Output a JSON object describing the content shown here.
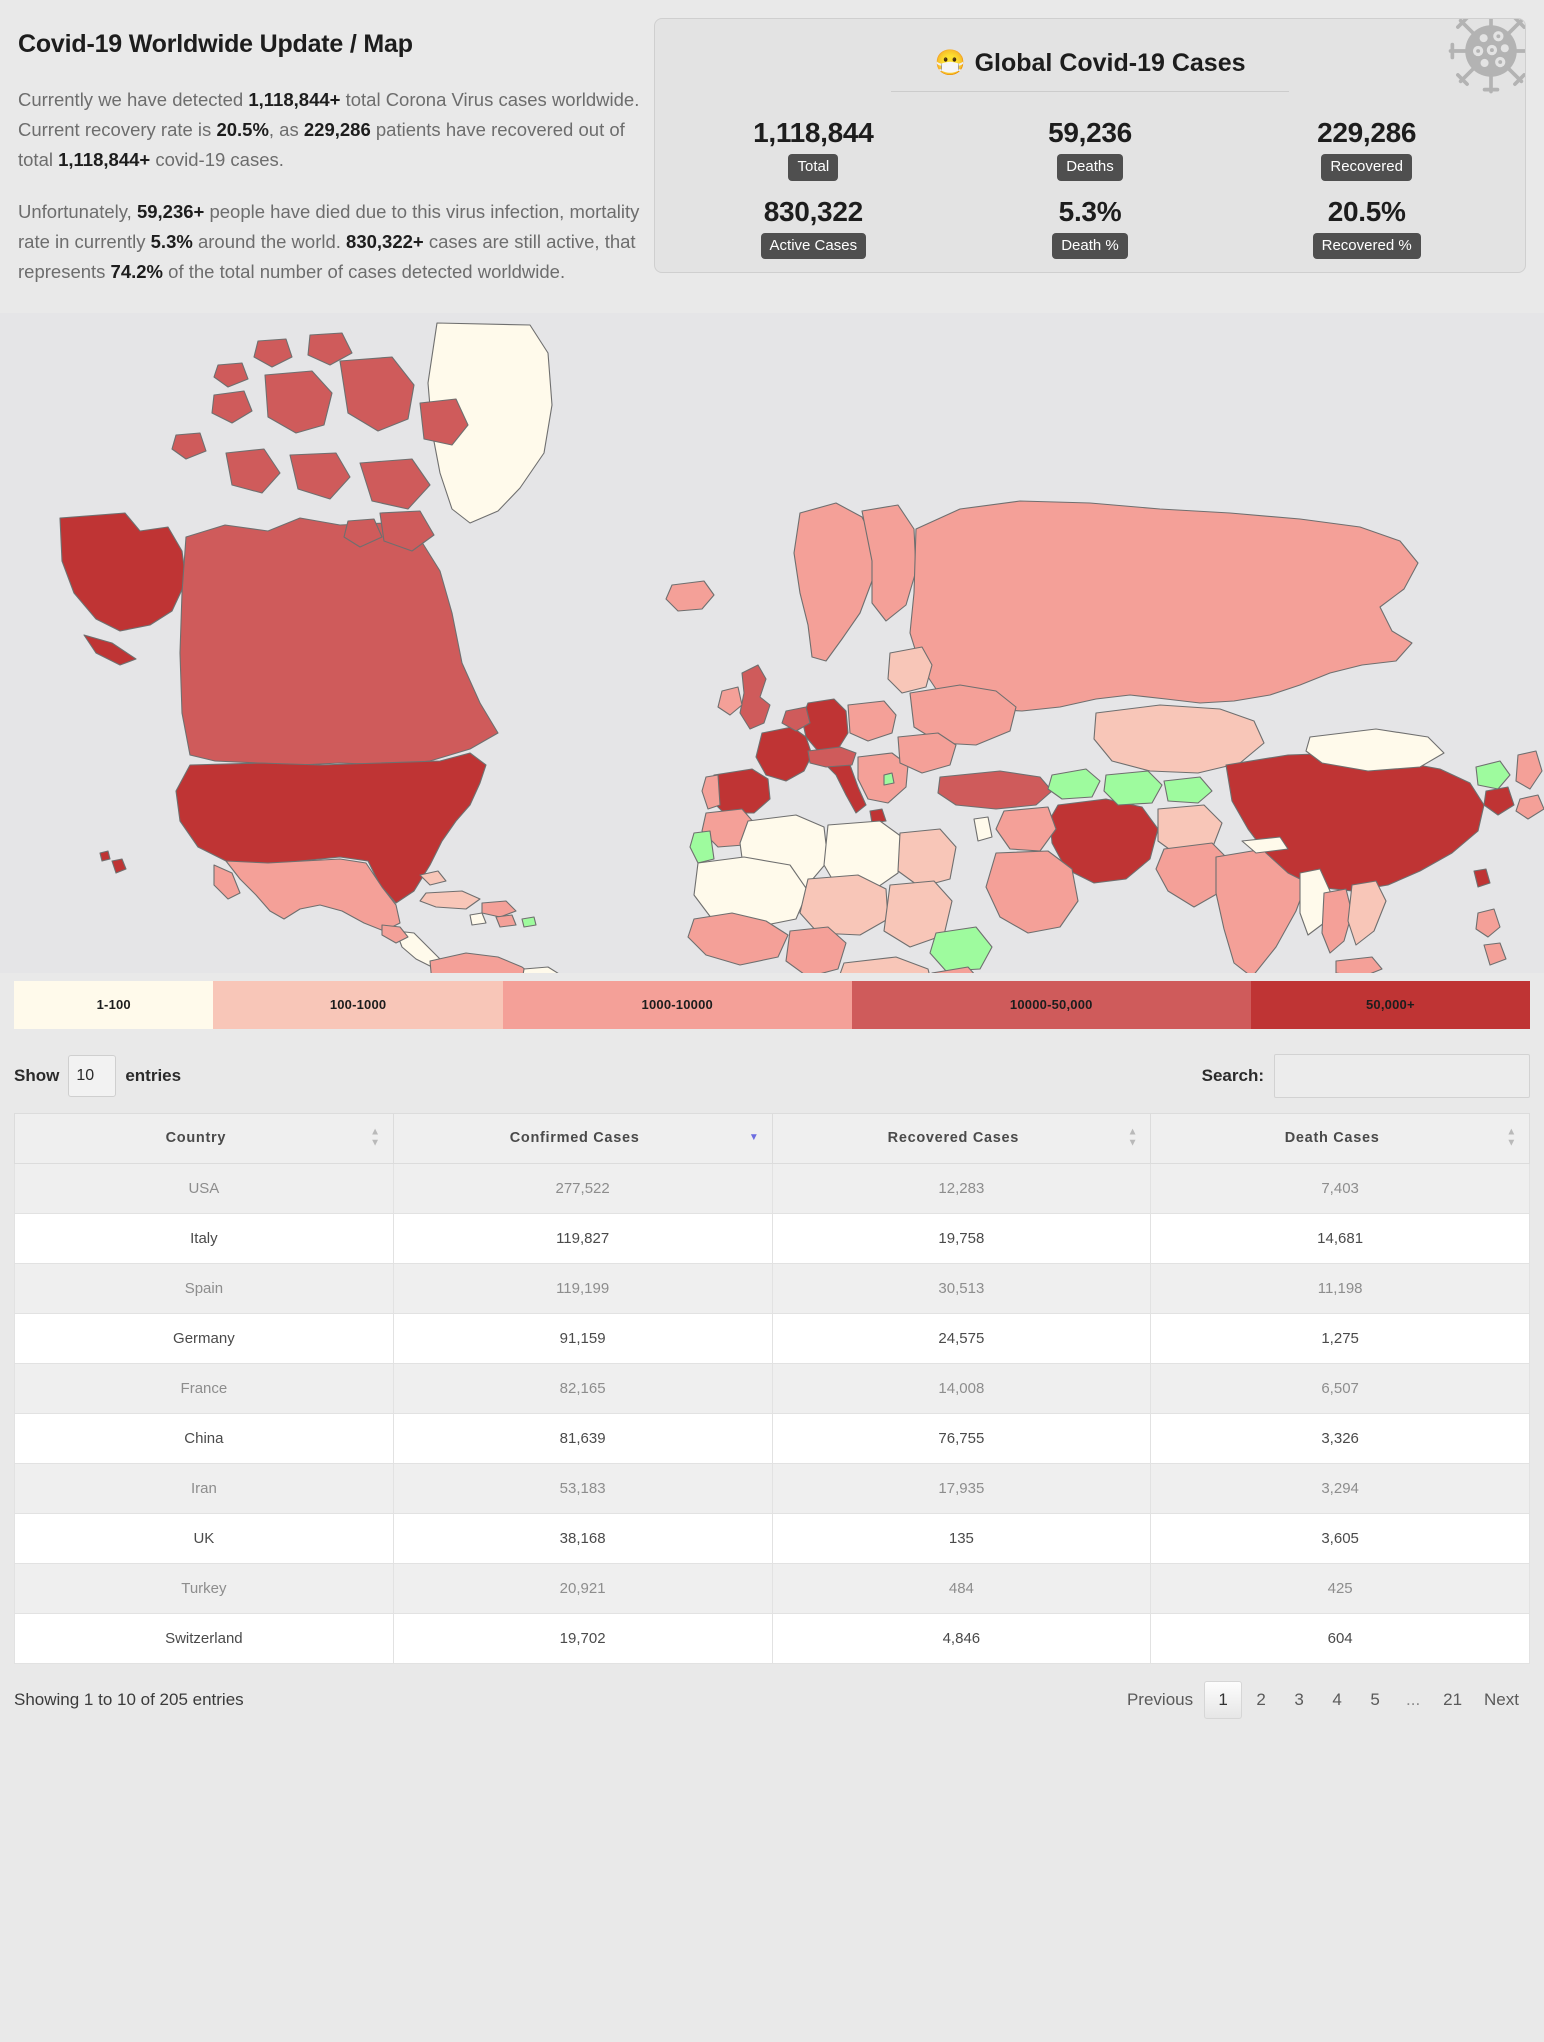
{
  "header": {
    "title": "Covid-19 Worldwide Update / Map",
    "paragraph1_a": "Currently we have detected ",
    "p1_b1": "1,118,844+",
    "paragraph1_b": " total Corona Virus cases worldwide. Current recovery rate is ",
    "p1_b2": "20.5%",
    "paragraph1_c": ", as ",
    "p1_b3": "229,286",
    "paragraph1_d": " patients have recovered out of total ",
    "p1_b4": "1,118,844+",
    "paragraph1_e": " covid-19 cases.",
    "paragraph2_a": "Unfortunately, ",
    "p2_b1": "59,236+",
    "paragraph2_b": " people have died due to this virus infection, mortality rate in currently ",
    "p2_b2": "5.3%",
    "paragraph2_c": " around the world. ",
    "p2_b3": "830,322+",
    "paragraph2_d": " cases are still active, that represents ",
    "p2_b4": "74.2%",
    "paragraph2_e": " of the total number of cases detected worldwide."
  },
  "stats_card": {
    "title": "Global Covid-19 Cases",
    "mask_emoji": "😷",
    "virus_icon": "coronavirus-icon",
    "stats": [
      {
        "value": "1,118,844",
        "label": "Total"
      },
      {
        "value": "59,236",
        "label": "Deaths"
      },
      {
        "value": "229,286",
        "label": "Recovered"
      },
      {
        "value": "830,322",
        "label": "Active Cases"
      },
      {
        "value": "5.3%",
        "label": "Death %"
      },
      {
        "value": "20.5%",
        "label": "Recovered %"
      }
    ]
  },
  "map": {
    "background": "#e5e5e7",
    "stroke": "#6f6f6f",
    "nodata_color": "#9efb9e"
  },
  "legend": {
    "items": [
      {
        "label": "1-100",
        "color": "#fffaeb",
        "flex": 1.0
      },
      {
        "label": "100-1000",
        "color": "#f8c6b8",
        "flex": 1.45
      },
      {
        "label": "1000-10000",
        "color": "#f4a098",
        "flex": 1.75
      },
      {
        "label": "10000-50,000",
        "color": "#cf5b5b",
        "flex": 2.0
      },
      {
        "label": "50,000+",
        "color": "#bf3434",
        "flex": 1.4
      }
    ]
  },
  "table_controls": {
    "show_label": "Show",
    "entries_label": "entries",
    "entries_value": "10",
    "search_label": "Search:",
    "search_value": "",
    "search_placeholder": ""
  },
  "chart_data": {
    "type": "table",
    "title": "Covid-19 Cases by Country",
    "columns": [
      "Country",
      "Confirmed Cases",
      "Recovered Cases",
      "Death Cases"
    ],
    "sorted_by": "Confirmed Cases",
    "sort_direction": "desc",
    "rows": [
      {
        "country": "USA",
        "confirmed": "277,522",
        "recovered": "12,283",
        "deaths": "7,403"
      },
      {
        "country": "Italy",
        "confirmed": "119,827",
        "recovered": "19,758",
        "deaths": "14,681"
      },
      {
        "country": "Spain",
        "confirmed": "119,199",
        "recovered": "30,513",
        "deaths": "11,198"
      },
      {
        "country": "Germany",
        "confirmed": "91,159",
        "recovered": "24,575",
        "deaths": "1,275"
      },
      {
        "country": "France",
        "confirmed": "82,165",
        "recovered": "14,008",
        "deaths": "6,507"
      },
      {
        "country": "China",
        "confirmed": "81,639",
        "recovered": "76,755",
        "deaths": "3,326"
      },
      {
        "country": "Iran",
        "confirmed": "53,183",
        "recovered": "17,935",
        "deaths": "3,294"
      },
      {
        "country": "UK",
        "confirmed": "38,168",
        "recovered": "135",
        "deaths": "3,605"
      },
      {
        "country": "Turkey",
        "confirmed": "20,921",
        "recovered": "484",
        "deaths": "425"
      },
      {
        "country": "Switzerland",
        "confirmed": "19,702",
        "recovered": "4,846",
        "deaths": "604"
      }
    ]
  },
  "table_footer": {
    "showing": "Showing 1 to 10 of 205 entries",
    "pager": [
      "Previous",
      "1",
      "2",
      "3",
      "4",
      "5",
      "...",
      "21",
      "Next"
    ],
    "current_page": "1"
  }
}
